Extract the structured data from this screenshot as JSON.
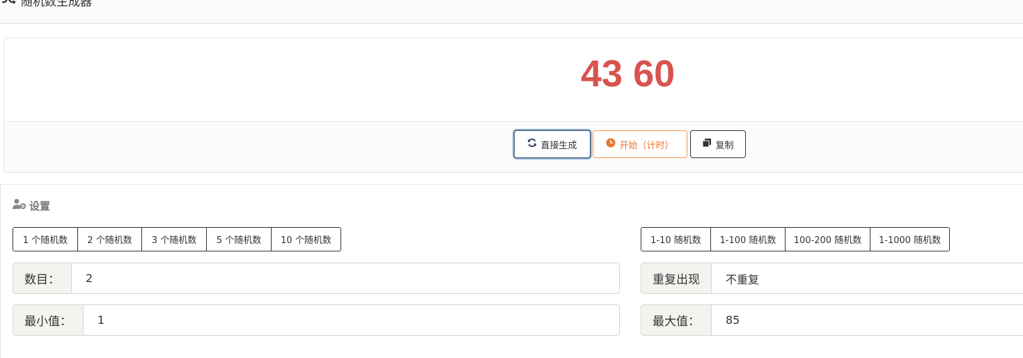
{
  "header": {
    "title": "随机数生成器",
    "icon": "shuffle-icon"
  },
  "result": {
    "display": "43 60",
    "values": [
      43,
      60
    ]
  },
  "actions": {
    "generate_label": "直接生成",
    "start_label": "开始（计时）",
    "copy_label": "复制"
  },
  "settings": {
    "title": "设置",
    "count_presets": [
      "1 个随机数",
      "2 个随机数",
      "3 个随机数",
      "5 个随机数",
      "10 个随机数"
    ],
    "range_presets": [
      "1-10 随机数",
      "1-100 随机数",
      "100-200 随机数",
      "1-1000 随机数"
    ],
    "count": {
      "label": "数目：",
      "value": "2"
    },
    "min": {
      "label": "最小值：",
      "value": "1"
    },
    "repeat": {
      "label": "重复出现",
      "value": "不重复"
    },
    "max": {
      "label": "最大值：",
      "value": "85"
    }
  },
  "colors": {
    "result_number": "#d9534f",
    "start_accent": "#e8772e",
    "generate_focus": "#8fb2d6"
  }
}
